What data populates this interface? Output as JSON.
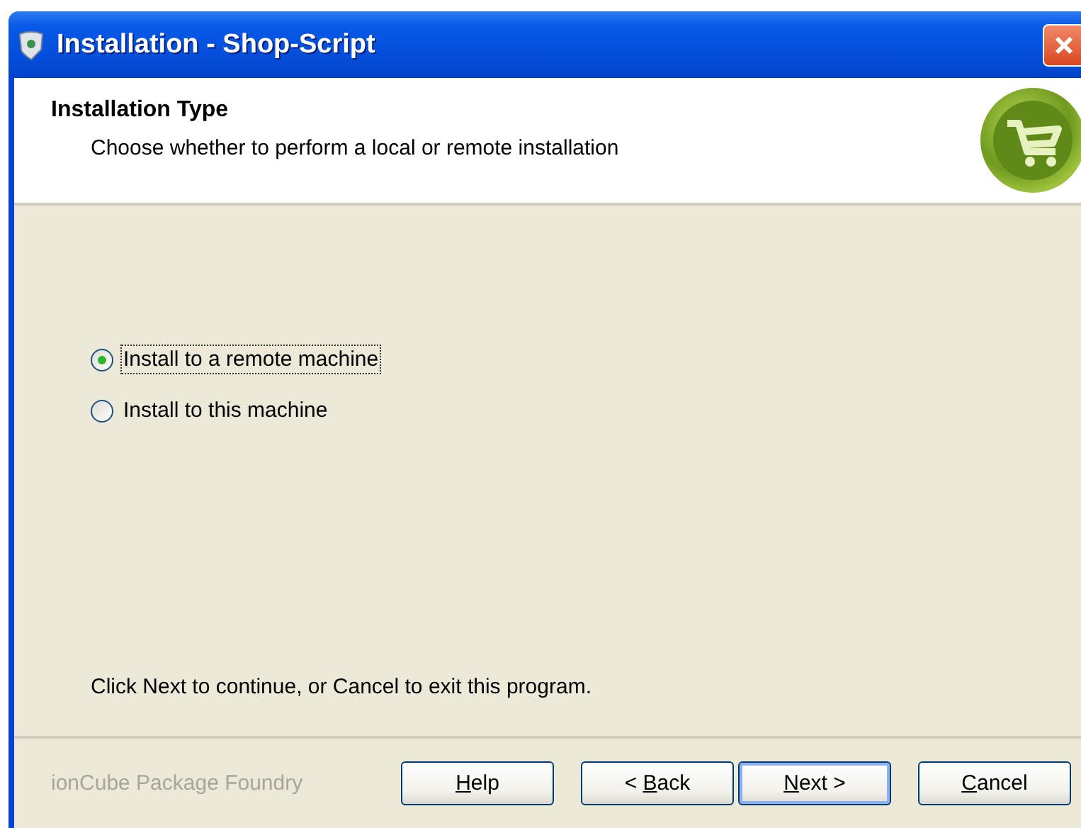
{
  "window": {
    "title": "Installation - Shop-Script"
  },
  "header": {
    "title": "Installation Type",
    "subtitle": "Choose whether to perform a local or remote installation"
  },
  "options": [
    {
      "label": "Install to a remote machine",
      "selected": true,
      "focused": true
    },
    {
      "label": "Install to this machine",
      "selected": false,
      "focused": false
    }
  ],
  "hint": "Click Next to continue, or Cancel to exit this program.",
  "footer": {
    "brand": "ionCube Package Foundry",
    "buttons": [
      {
        "key": "H",
        "after": "elp",
        "default": false
      },
      {
        "before": "< ",
        "key": "B",
        "after": "ack",
        "default": false
      },
      {
        "key": "N",
        "after": "ext >",
        "default": true
      },
      {
        "key": "C",
        "after": "ancel",
        "default": false
      }
    ]
  }
}
